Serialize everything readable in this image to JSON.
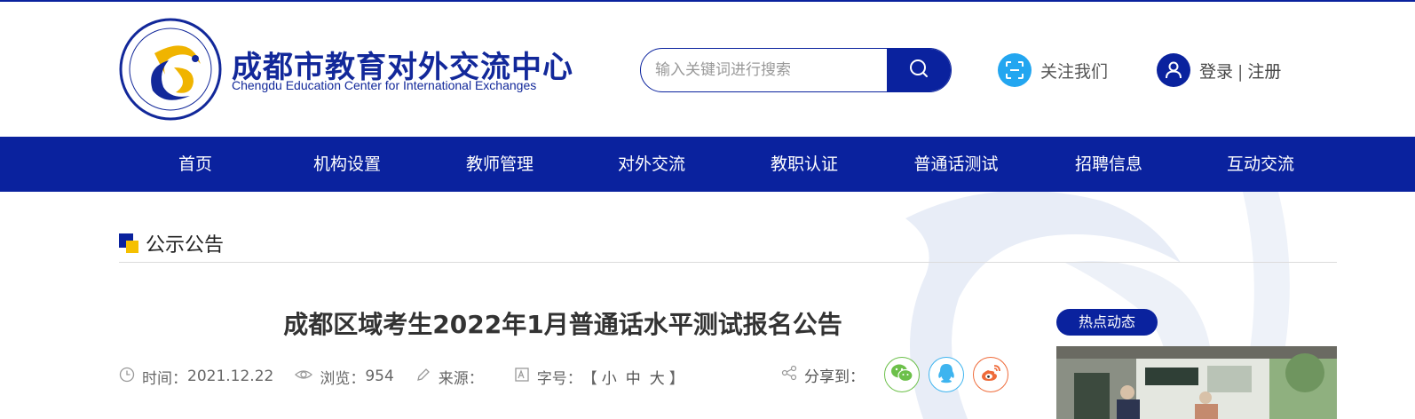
{
  "header": {
    "logo_cn": "成都市教育对外交流中心",
    "logo_en": "Chengdu Education Center for International Exchanges",
    "search_placeholder": "输入关键词进行搜索",
    "follow_label": "关注我们",
    "login_label": "登录",
    "separator": "|",
    "register_label": "注册"
  },
  "nav": {
    "items": [
      {
        "label": "首页"
      },
      {
        "label": "机构设置"
      },
      {
        "label": "教师管理"
      },
      {
        "label": "对外交流"
      },
      {
        "label": "教职认证"
      },
      {
        "label": "普通话测试"
      },
      {
        "label": "招聘信息"
      },
      {
        "label": "互动交流"
      }
    ]
  },
  "section": {
    "title": "公示公告"
  },
  "article": {
    "title": "成都区域考生2022年1月普通话水平测试报名公告",
    "time_label": "时间：",
    "time_value": "2021.12.22",
    "views_label": "浏览：",
    "views_value": "954",
    "source_label": "来源：",
    "font_size_label": "字号：",
    "bracket_open": "【",
    "font_small": "小",
    "font_medium": "中",
    "font_large": "大",
    "bracket_close": "】",
    "share_label": "分享到："
  },
  "sidebar": {
    "hot_label": "热点动态"
  },
  "colors": {
    "brand_blue": "#0a229e",
    "accent_yellow": "#f5c000",
    "wechat_green": "#6cc04a",
    "qq_blue": "#3eb4ef",
    "weibo_orange": "#ef6b3a",
    "follow_cyan": "#23a6f0"
  }
}
